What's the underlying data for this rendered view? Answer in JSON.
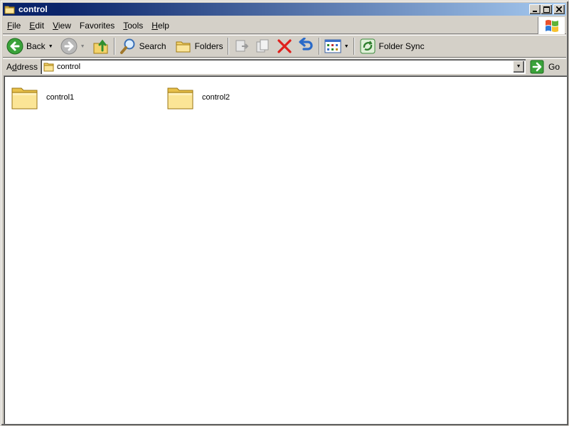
{
  "window": {
    "title": "control"
  },
  "menu": [
    {
      "accel": "F",
      "rest": "ile"
    },
    {
      "accel": "E",
      "rest": "dit"
    },
    {
      "accel": "V",
      "rest": "iew"
    },
    {
      "accel": "F",
      "rest": "avorites",
      "prefix": ""
    },
    {
      "accel": "T",
      "rest": "ools"
    },
    {
      "accel": "H",
      "rest": "elp"
    }
  ],
  "toolbar": {
    "back_label": "Back",
    "search_label": "Search",
    "folders_label": "Folders",
    "folder_sync_label": "Folder Sync"
  },
  "address": {
    "label_accel": "d",
    "label_prefix": "A",
    "label_rest": "dress",
    "value": "control",
    "go_label": "Go"
  },
  "items": [
    {
      "name": "control1",
      "icon": "folder-icon"
    },
    {
      "name": "control2",
      "icon": "folder-icon"
    }
  ],
  "colors": {
    "title_active": "#0a246a",
    "face": "#d4d0c8",
    "content_bg": "#ffffff"
  }
}
